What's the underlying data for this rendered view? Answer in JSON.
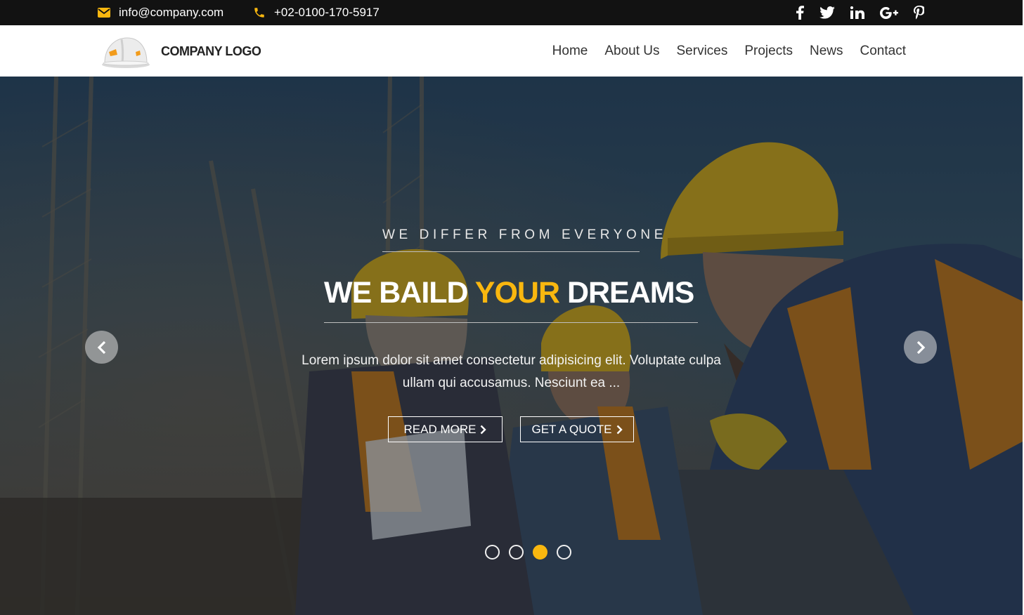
{
  "topbar": {
    "email": "info@company.com",
    "phone": "+02-0100-170-5917",
    "social": [
      {
        "icon": "facebook-icon",
        "label": "f"
      },
      {
        "icon": "twitter-icon",
        "label": "t"
      },
      {
        "icon": "linkedin-icon",
        "label": "in"
      },
      {
        "icon": "google-plus-icon",
        "label": "G+"
      },
      {
        "icon": "pinterest-icon",
        "label": "p"
      }
    ]
  },
  "header": {
    "logo_text": "COMPANY LOGO",
    "nav": [
      "Home",
      "About Us",
      "Services",
      "Projects",
      "News",
      "Contact"
    ]
  },
  "hero": {
    "tagline": "WE DIFFER FROM EVERYONE",
    "headline_part1": "WE BAILD ",
    "headline_accent": "YOUR",
    "headline_part2": " DREAMS",
    "description": "Lorem ipsum dolor sit amet consectetur adipisicing elit. Voluptate culpa ullam qui accusamus. Nesciunt ea ...",
    "read_more": "READ MORE",
    "get_quote": "GET A QUOTE",
    "slides_count": 4,
    "active_slide": 3
  },
  "colors": {
    "accent": "#f9b70f",
    "topbar_bg": "#121212",
    "header_bg": "#ffffff"
  }
}
